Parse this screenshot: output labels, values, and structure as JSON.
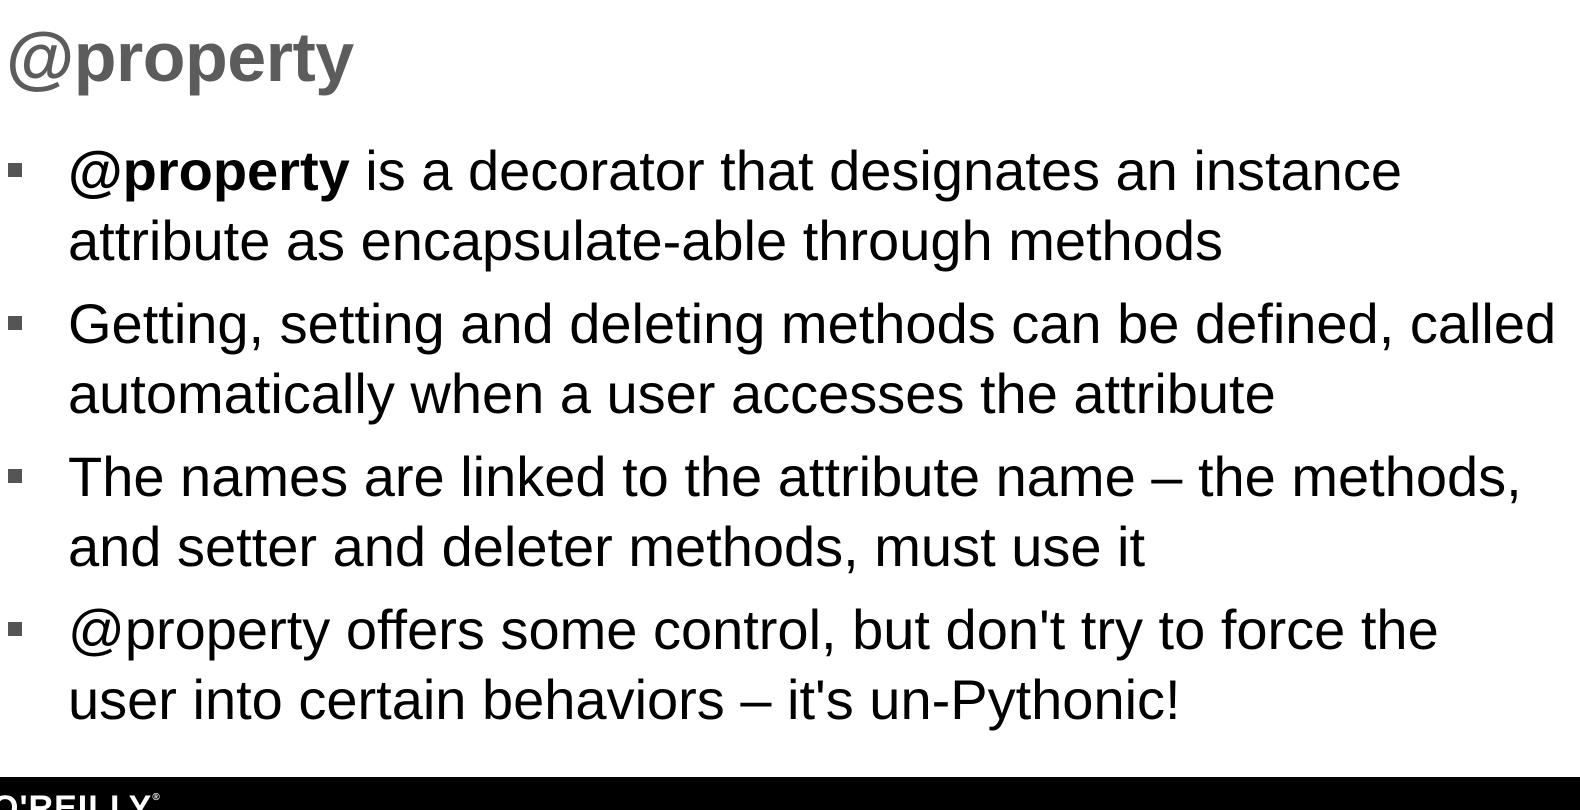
{
  "slide": {
    "title": "@property",
    "bullets": [
      {
        "bold_lead": "@property",
        "text": " is a decorator that designates an instance attribute as encapsulate-able through methods"
      },
      {
        "bold_lead": "",
        "text": "Getting, setting and deleting methods can be defined, called automatically when a user accesses the attribute"
      },
      {
        "bold_lead": "",
        "text": "The names are linked to the attribute name – the methods, and setter and deleter methods, must use it"
      },
      {
        "bold_lead": "",
        "text": "@property offers some control, but don't try to force the user into certain behaviors – it's un-Pythonic!"
      }
    ]
  },
  "footer": {
    "logo_text": "O'REILLY",
    "logo_mark": "®"
  }
}
